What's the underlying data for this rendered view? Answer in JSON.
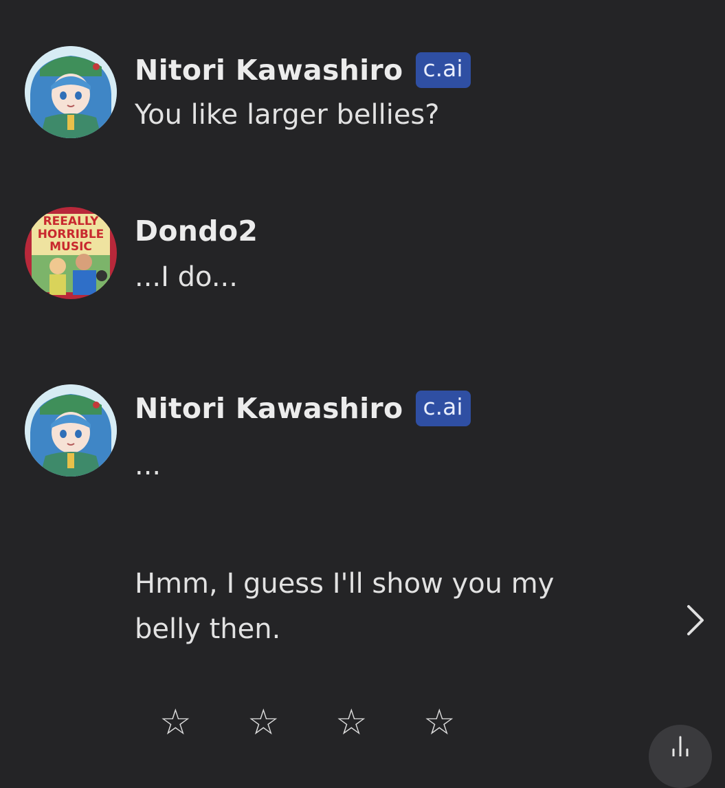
{
  "messages": [
    {
      "name": "Nitori Kawashiro",
      "badge": "c.ai",
      "lines": [
        "You like larger bellies?"
      ]
    },
    {
      "name": "Dondo2",
      "lines": [
        "...I do..."
      ]
    },
    {
      "name": "Nitori Kawashiro",
      "badge": "c.ai",
      "lines": [
        "...",
        "Hmm, I guess I'll show you my",
        "belly then."
      ]
    }
  ],
  "avatar_text": [
    "REEALLY",
    "HORRIBLE",
    "MUSIC"
  ],
  "rating": {
    "stars": [
      "☆",
      "☆",
      "☆",
      "☆"
    ]
  },
  "icons": {
    "next": "chevron-right-icon",
    "scroll": "scroll-down-icon"
  },
  "colors": {
    "background": "#242426",
    "badge": "#2f4fa3",
    "text": "#e2e2e2"
  }
}
